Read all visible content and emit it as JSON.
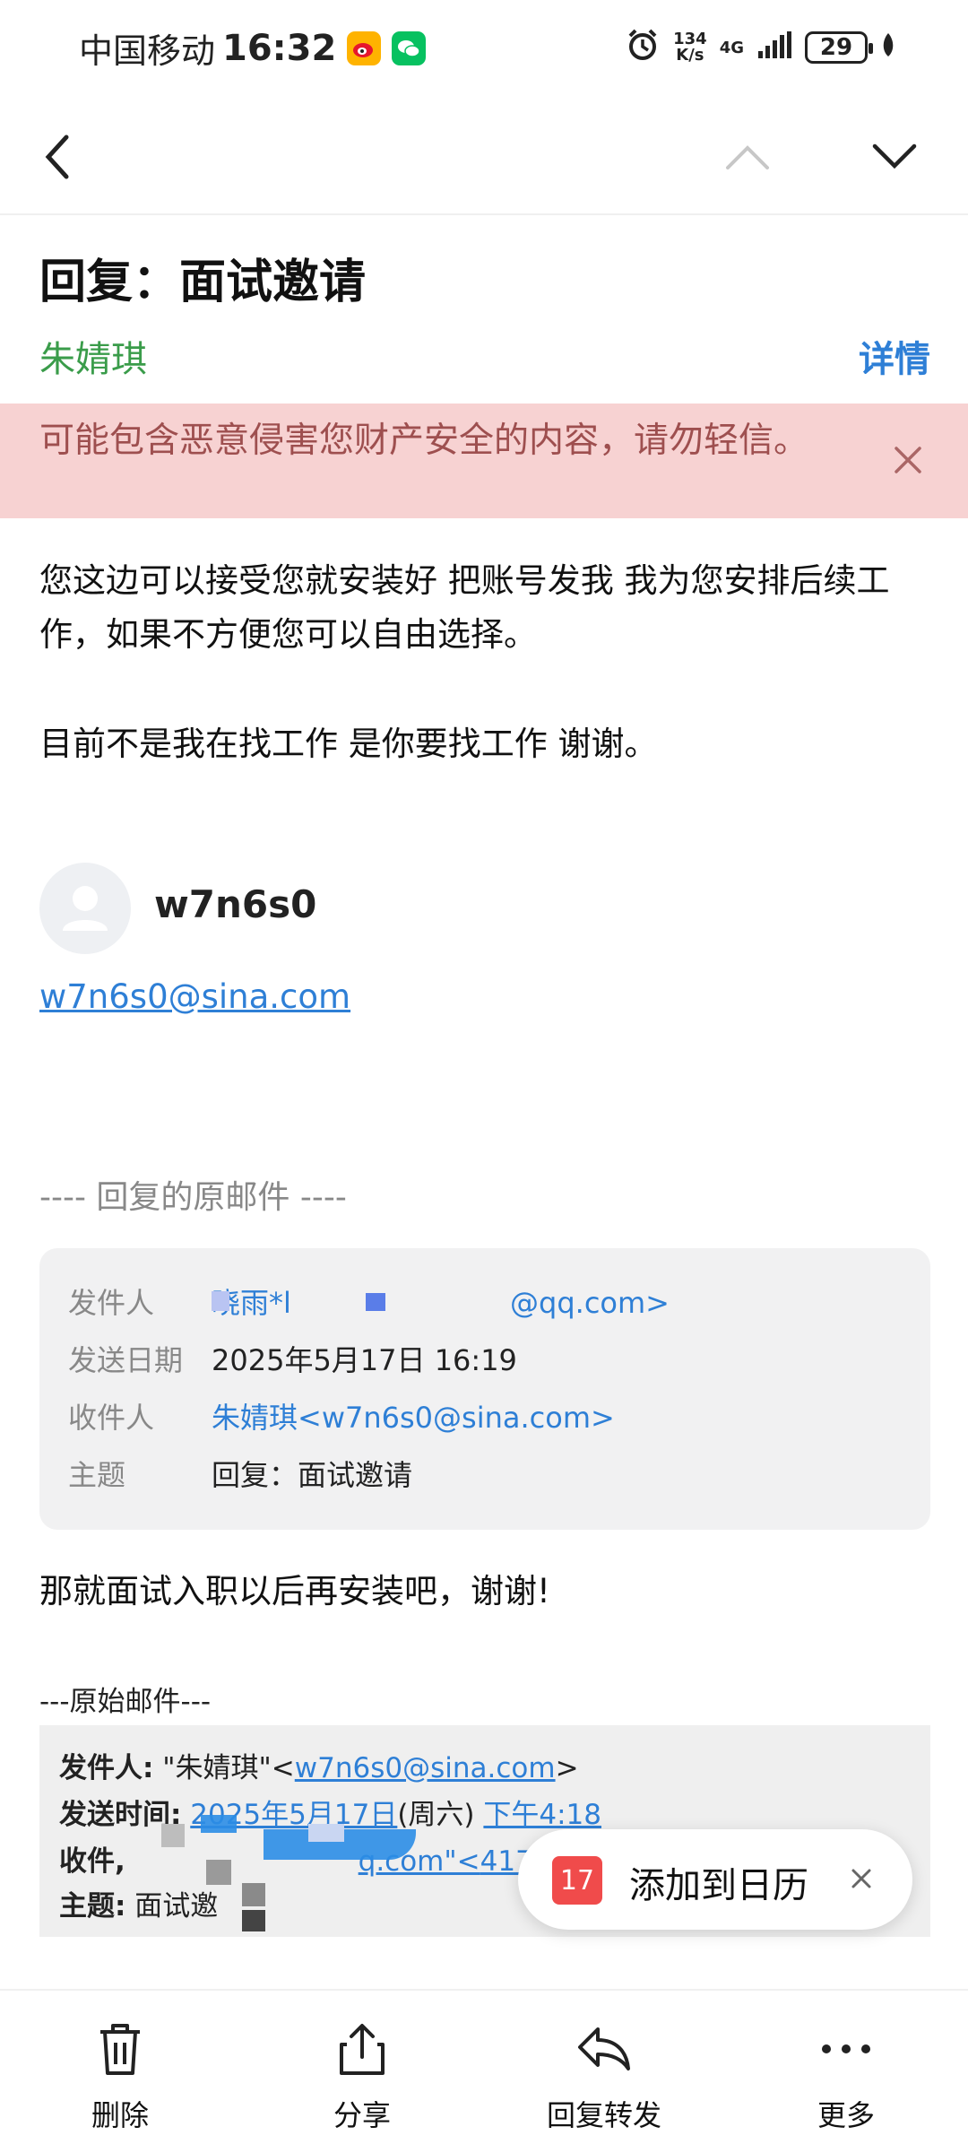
{
  "status_bar": {
    "carrier": "中国移动",
    "time": "16:32",
    "net_speed_value": "134",
    "net_speed_unit": "K/s",
    "network": "4G",
    "battery": "29"
  },
  "email": {
    "subject": "回复：面试邀请",
    "sender": "朱婧琪",
    "details_label": "详情",
    "warning": "可能包含恶意侵害您财产安全的内容，请勿轻信。",
    "body_line1": "您这边可以接受您就安装好 把账号发我  我为您安排后续工",
    "body_line2": "作，如果不方便您可以自由选择。",
    "body_line3": "目前不是我在找工作  是你要找工作   谢谢。",
    "signature_name": "w7n6s0",
    "signature_email": "w7n6s0@sina.com"
  },
  "original": {
    "divider": "---- 回复的原邮件 ----",
    "rows": [
      {
        "label": "发件人",
        "value": "晓雨*l                        @qq.com>"
      },
      {
        "label": "发送日期",
        "value": "2025年5月17日 16:19"
      },
      {
        "label": "收件人",
        "value": "朱婧琪<w7n6s0@sina.com>"
      },
      {
        "label": "主题",
        "value": "回复：面试邀请"
      }
    ],
    "reply_text": "那就面试入职以后再安装吧，谢谢!"
  },
  "raw": {
    "divider": "---原始邮件---",
    "from_label": "发件人:",
    "from_name": "\"朱婧琪\"<",
    "from_email": "w7n6s0@sina.com",
    "from_end": ">",
    "time_label": "发送时间:",
    "time_date": "2025年5月17日",
    "time_week": "(周六)",
    "time_clock": "下午4:18",
    "to_label": "收件,",
    "to_value": "q.com\"<",
    "to_link": "417",
    "subject_label": "主题:",
    "subject_value": "面试邀"
  },
  "calendar_toast": {
    "day": "17",
    "label": "添加到日历"
  },
  "toolbar": {
    "delete": "删除",
    "share": "分享",
    "reply_forward": "回复转发",
    "more": "更多"
  },
  "colors": {
    "accent_blue": "#2e7fd6",
    "sender_green": "#3a9c4a",
    "warning_bg": "#f7d2d2",
    "warning_text": "#9e4f4f"
  }
}
